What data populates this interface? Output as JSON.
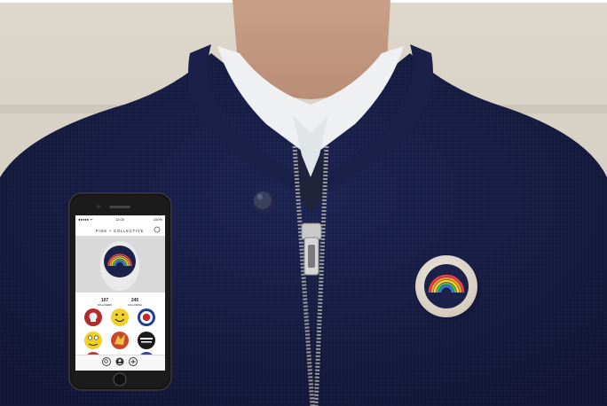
{
  "photo": {
    "subject": "jacket-with-badge",
    "colors": {
      "wall": "#d8d2c7",
      "wall_shadow": "#c9c2b6",
      "jacket": "#1d2452",
      "jacket_dark": "#151a3c",
      "collar": "#1a2048",
      "shirt": "#eef0f2",
      "skin": "#c7a08a",
      "zipper": "#c9c9c9",
      "badge_rim": "#e4dcd0",
      "badge_face": "#1b2148"
    }
  },
  "phone": {
    "status_left": "●●●●● ᯤ",
    "status_time": "12:00",
    "status_right": "100%",
    "app_title": "PINS + COLLECTIVE",
    "stats": [
      {
        "value": "107",
        "label": "FOLLOWERS"
      },
      {
        "value": "245",
        "label": "FOLLOWING"
      }
    ],
    "pins": [
      {
        "icon": "skull-pin-icon",
        "color": "#b22b2b"
      },
      {
        "icon": "smiley-pin-icon",
        "color": "#f2d02a"
      },
      {
        "icon": "roundel-pin-icon",
        "color": "#c8272d"
      },
      {
        "icon": "face-pin-icon",
        "color": "#f2d02a"
      },
      {
        "icon": "bird-pin-icon",
        "color": "#c9482b"
      },
      {
        "icon": "text-pin-icon",
        "color": "#1b1b1b"
      }
    ],
    "tabbar": [
      "search-icon",
      "profile-icon",
      "add-icon"
    ]
  }
}
